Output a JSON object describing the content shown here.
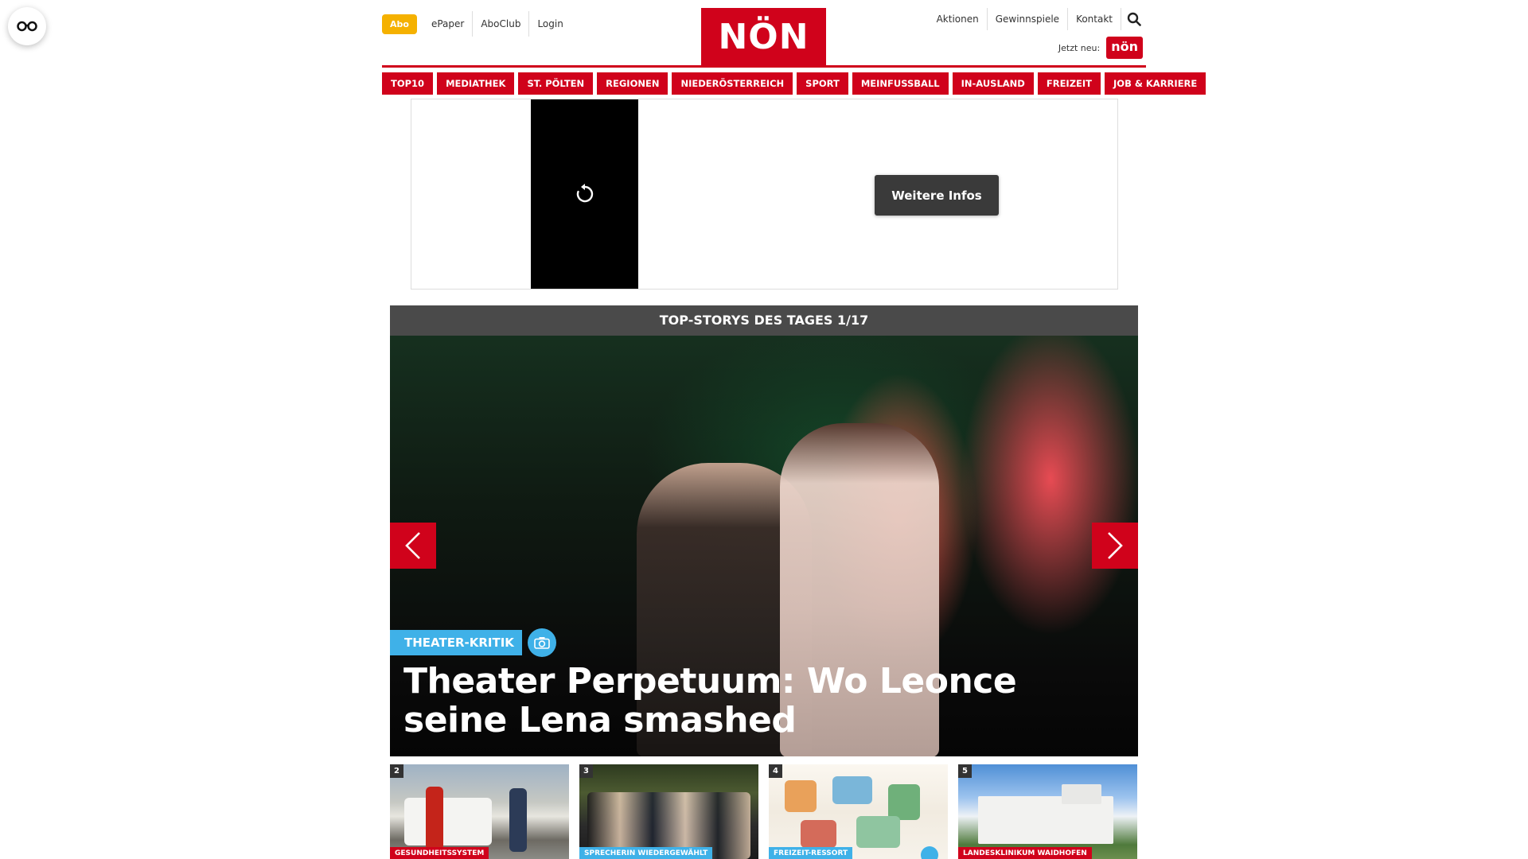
{
  "accessibility": {
    "icon": "glasses-icon"
  },
  "header": {
    "abo_label": "Abo",
    "left_links": [
      "ePaper",
      "AboClub",
      "Login"
    ],
    "logo_text": "NÖN",
    "right_links": [
      "Aktionen",
      "Gewinnspiele",
      "Kontakt"
    ],
    "search_icon": "search-icon",
    "jetzt_label": "Jetzt neu:",
    "jetzt_badge": "nön"
  },
  "nav": {
    "items": [
      "TOP10",
      "MEDIATHEK",
      "ST. PÖLTEN",
      "REGIONEN",
      "NIEDERÖSTERREICH",
      "SPORT",
      "MEINFUSSBALL",
      "IN-AUSLAND",
      "FREIZEIT",
      "JOB & KARRIERE"
    ]
  },
  "ad": {
    "button_label": "Weitere Infos",
    "replay_icon": "replay-icon"
  },
  "slider": {
    "header": "TOP-STORYS DES TAGES 1/17",
    "category": "THEATER-KRITIK",
    "title": "Theater Perpetuum: Wo Leonce seine Lena smashed",
    "prev_icon": "chevron-left-icon",
    "next_icon": "chevron-right-icon",
    "camera_icon": "camera-icon"
  },
  "thumbs": [
    {
      "num": "2",
      "category": "GESUNDHEITSSYSTEM"
    },
    {
      "num": "3",
      "category": "SPRECHERIN WIEDERGEWÄHLT"
    },
    {
      "num": "4",
      "category": "FREIZEIT-RESSORT"
    },
    {
      "num": "5",
      "category": "LANDESKLINIKUM WAIDHOFEN"
    }
  ],
  "colors": {
    "brand_red": "#d0021b",
    "abo_yellow": "#f5b100",
    "accent_blue": "#3fb1e8"
  }
}
